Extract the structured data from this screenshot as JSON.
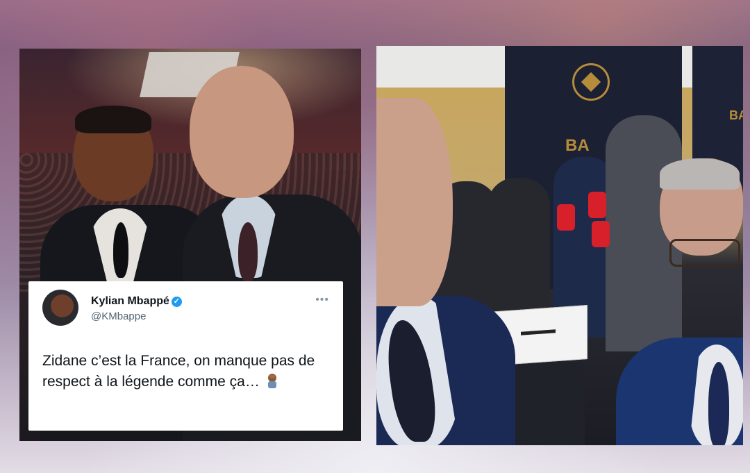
{
  "tweet": {
    "name": "Kylian Mbappé",
    "handle": "@KMbappe",
    "text": "Zidane c’est la France, on manque pas de respect à la légende comme ça…",
    "icons": {
      "verified": "verified-badge-icon",
      "more": "more-options-icon",
      "emoji": "facepalm-emoji-icon"
    }
  },
  "photo_right": {
    "banner_text_1": "BA",
    "banner_text_2": "BA"
  },
  "colors": {
    "twitter_blue": "#1d9bf0",
    "text_primary": "#0f1419",
    "text_secondary": "#536471",
    "ballon_gold": "#b58c3a",
    "banner_navy": "#1c2033"
  }
}
